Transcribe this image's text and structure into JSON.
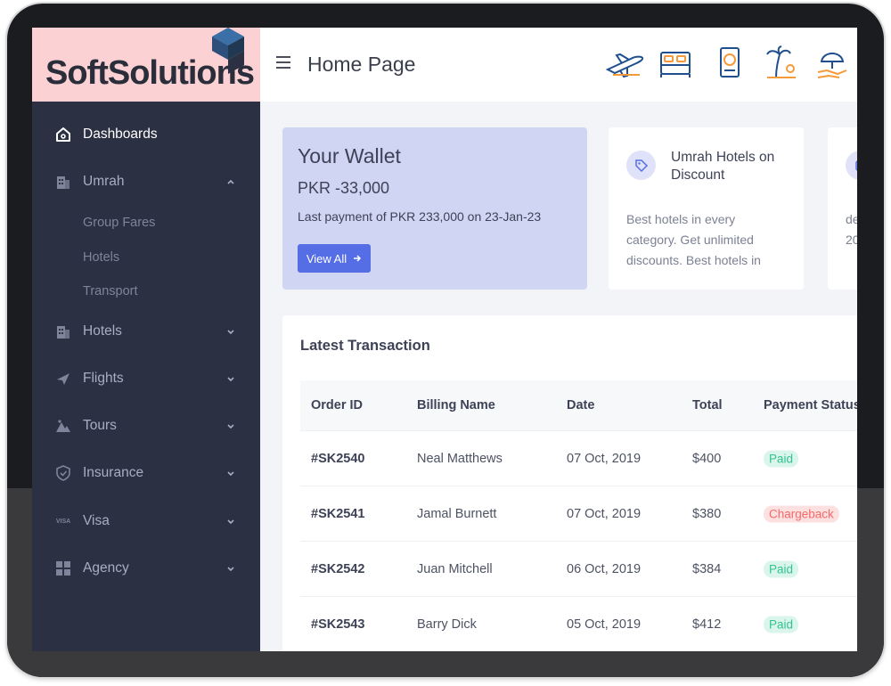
{
  "brand": {
    "name": "SoftSolutions"
  },
  "header": {
    "title": "Home Page",
    "icons": [
      "airplane-icon",
      "hotel-bed-icon",
      "passport-icon",
      "beach-palm-icon",
      "insurance-hand-icon"
    ]
  },
  "sidebar": {
    "items": [
      {
        "label": "Dashboards",
        "icon": "home-icon",
        "active": true
      },
      {
        "label": "Umrah",
        "icon": "building-icon",
        "expanded": true,
        "children": [
          "Group Fares",
          "Hotels",
          "Transport"
        ]
      },
      {
        "label": "Hotels",
        "icon": "building-icon"
      },
      {
        "label": "Flights",
        "icon": "plane-icon"
      },
      {
        "label": "Tours",
        "icon": "mountain-icon"
      },
      {
        "label": "Insurance",
        "icon": "shield-icon"
      },
      {
        "label": "Visa",
        "icon": "visa-icon",
        "icon_text": "VISA"
      },
      {
        "label": "Agency",
        "icon": "grid-icon"
      }
    ]
  },
  "wallet": {
    "title": "Your Wallet",
    "amount": "PKR -33,000",
    "note": "Last payment of PKR 233,000 on 23-Jan-23",
    "button": "View All"
  },
  "promos": [
    {
      "title": "Umrah Hotels on Discount",
      "desc": "Best hotels in every category. Get unlimited discounts. Best hotels in"
    },
    {
      "title": "",
      "desc_lines": [
        "de",
        "20"
      ]
    }
  ],
  "transactions": {
    "title": "Latest Transaction",
    "columns": [
      "Order ID",
      "Billing Name",
      "Date",
      "Total",
      "Payment Status"
    ],
    "rows": [
      {
        "id": "#SK2540",
        "name": "Neal Matthews",
        "date": "07 Oct, 2019",
        "total": "$400",
        "status": "Paid"
      },
      {
        "id": "#SK2541",
        "name": "Jamal Burnett",
        "date": "07 Oct, 2019",
        "total": "$380",
        "status": "Chargeback"
      },
      {
        "id": "#SK2542",
        "name": "Juan Mitchell",
        "date": "06 Oct, 2019",
        "total": "$384",
        "status": "Paid"
      },
      {
        "id": "#SK2543",
        "name": "Barry Dick",
        "date": "05 Oct, 2019",
        "total": "$412",
        "status": "Paid"
      }
    ]
  },
  "colors": {
    "sidebar": "#2b3042",
    "brand_bg": "#fbd1d3",
    "accent": "#556ee6",
    "wallet_bg": "#d0d5f3",
    "paid_bg": "#d9f5ec",
    "paid_text": "#34c38f",
    "chargeback_bg": "#fde1e1",
    "chargeback_text": "#f46a6a"
  }
}
